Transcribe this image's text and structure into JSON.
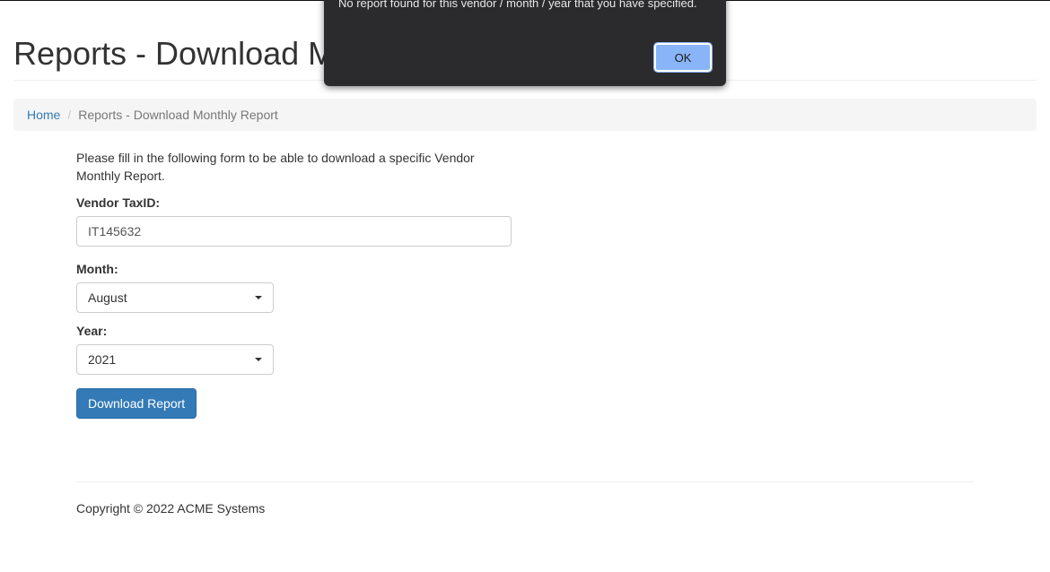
{
  "page": {
    "title": "Reports - Download Monthly Report"
  },
  "breadcrumb": {
    "home": "Home",
    "separator": "/",
    "current": "Reports - Download Monthly Report"
  },
  "form": {
    "intro": "Please fill in the following form to be able to download a specific Vendor Monthly Report.",
    "vendor_label": "Vendor TaxID:",
    "vendor_value": "IT145632",
    "month_label": "Month:",
    "month_value": "August",
    "year_label": "Year:",
    "year_value": "2021",
    "submit_label": "Download Report"
  },
  "footer": {
    "copyright": "Copyright © 2022 ACME Systems"
  },
  "dialog": {
    "message": "No report found for this vendor / month / year that you have specified.",
    "ok_label": "OK"
  },
  "colors": {
    "primary": "#337ab7",
    "link": "#337ab7",
    "dialog_bg": "#2b2b2d",
    "dialog_button": "#8ab4f8"
  },
  "icons": {
    "select_caret": "caret-down-icon"
  }
}
